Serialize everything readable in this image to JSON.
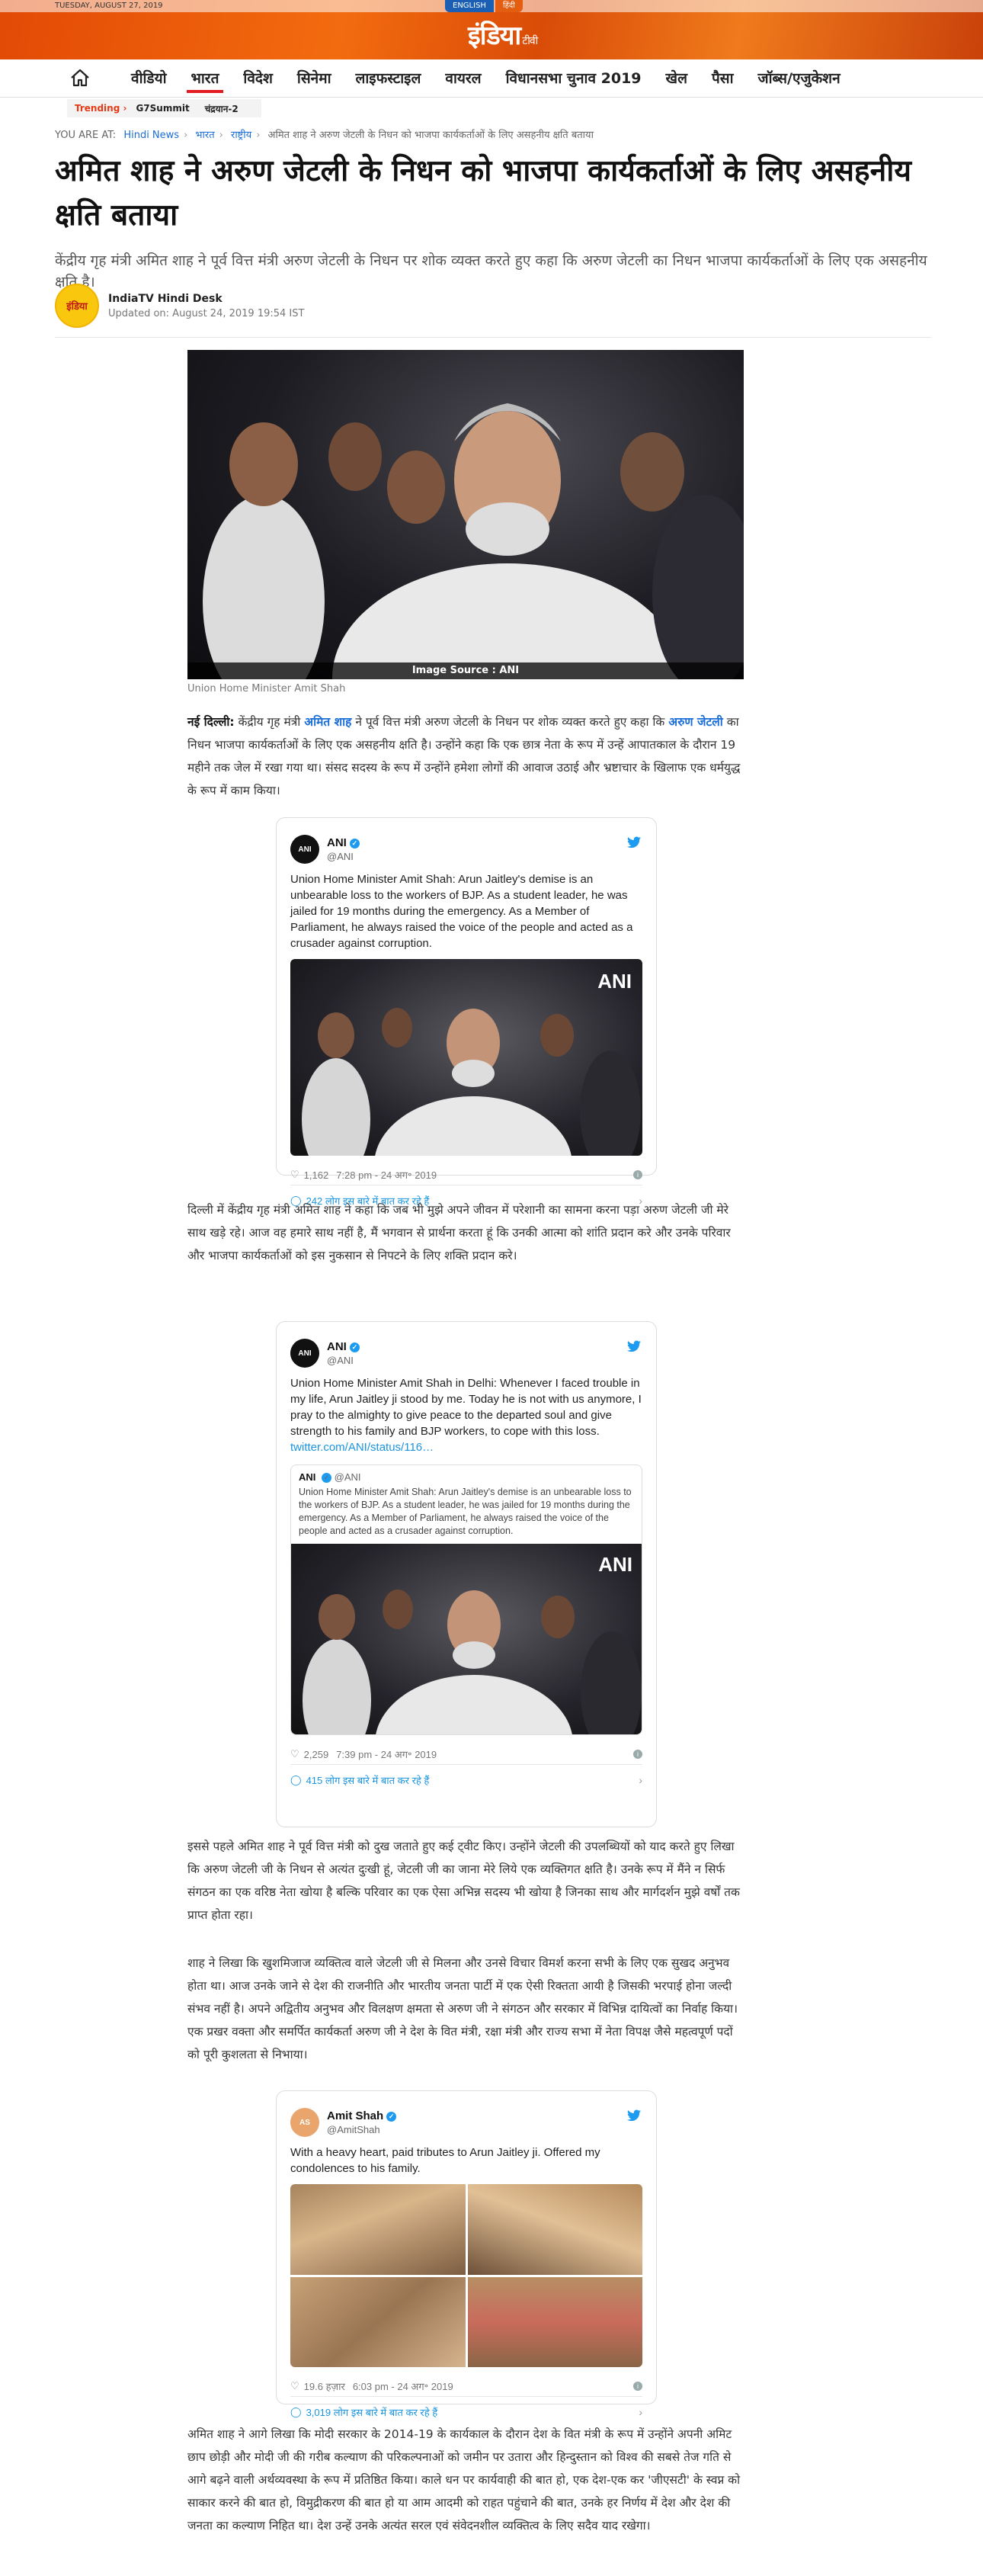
{
  "topbar": {
    "date": "TUESDAY, AUGUST 27, 2019",
    "lang_english": "ENGLISH",
    "lang_hindi": "हिंदी",
    "logo": "इंडिया",
    "logo_tv": "टीवी"
  },
  "nav": {
    "items": [
      {
        "label": "वीडियो"
      },
      {
        "label": "भारत"
      },
      {
        "label": "विदेश"
      },
      {
        "label": "सिनेमा"
      },
      {
        "label": "लाइफस्टाइल"
      },
      {
        "label": "वायरल"
      },
      {
        "label": "विधानसभा चुनाव 2019"
      },
      {
        "label": "खेल"
      },
      {
        "label": "पैसा"
      },
      {
        "label": "जॉब्स/एजुकेशन"
      }
    ],
    "active": "भारत"
  },
  "trending": {
    "label": "Trending ›",
    "links": [
      "G7Summit",
      "चंद्रयान-2"
    ]
  },
  "breadcrumb": {
    "prefix": "YOU ARE AT:",
    "items": [
      "Hindi News",
      "भारत",
      "राष्ट्रीय",
      "अमित शाह ने अरुण जेटली के निधन को भाजपा कार्यकर्ताओं के लिए असहनीय क्षति बताया"
    ]
  },
  "article": {
    "title": "अमित शाह ने अरुण जेटली के निधन को भाजपा कार्यकर्ताओं के लिए असहनीय क्षति बताया",
    "summary": "केंद्रीय गृह मंत्री अमित शाह ने पूर्व वित्त मंत्री अरुण जेटली के निधन पर शोक व्यक्त करते हुए कहा कि अरुण जेटली का निधन भाजपा कार्यकर्ताओं के लिए एक असहनीय क्षति है।",
    "author": "IndiaTV Hindi Desk",
    "author_badge": "इंडिया",
    "updated": "Updated on: August 24, 2019 19:54 IST",
    "image_credit": "Image Source : ANI",
    "image_caption": "Union Home Minister Amit Shah",
    "p1_dateline": "नई दिल्ली:",
    "p1_a": " केंद्रीय गृह मंत्री ",
    "p1_link1": "अमित शाह",
    "p1_b": " ने पूर्व वित्त मंत्री अरुण जेटली के निधन पर शोक व्यक्त करते हुए कहा कि ",
    "p1_link2": "अरुण जेटली",
    "p1_c": " का निधन भाजपा कार्यकर्ताओं के लिए एक असहनीय क्षति है। उन्होंने कहा कि एक छात्र नेता के रूप में उन्हें आपातकाल के दौरान 19 महीने तक जेल में रखा गया था। संसद सदस्य के रूप में उन्होंने हमेशा लोगों की आवाज उठाई और भ्रष्टाचार के खिलाफ एक धर्मयुद्ध के रूप में काम किया।",
    "p2": "दिल्ली में केंद्रीय गृह मंत्री अमित शाह ने कहा कि जब भी मुझे अपने जीवन में परेशानी का सामना करना पड़ा अरुण जेटली जी मेरे साथ खड़े रहे। आज वह हमारे साथ नहीं है, मैं भगवान से प्रार्थना करता हूं कि उनकी आत्मा को शांति प्रदान करे और उनके परिवार और भाजपा कार्यकर्ताओं को इस नुकसान से निपटने के लिए शक्ति प्रदान करे।",
    "p3": "इससे पहले अमित शाह ने पूर्व वित्त मंत्री को दुख जताते हुए कई ट्वीट किए। उन्होंने जेटली की उपलब्धियों को याद करते हुए लिखा कि अरुण जेटली जी के निधन से अत्यंत दुःखी हूं, जेटली जी का जाना मेरे लिये एक व्यक्तिगत क्षति है। उनके रूप में मैंने न सिर्फ संगठन का एक वरिष्ठ नेता खोया है बल्कि परिवार का एक ऐसा अभिन्न सदस्य भी खोया है जिनका साथ और मार्गदर्शन मुझे वर्षों तक प्राप्त होता रहा।",
    "p4": "शाह ने लिखा कि खुशमिजाज व्यक्तित्व वाले जेटली जी से मिलना और उनसे विचार विमर्श करना सभी के लिए एक सुखद अनुभव होता था। आज उनके जाने से देश की राजनीति और भारतीय जनता पार्टी में एक ऐसी रिक्तता आयी है जिसकी भरपाई होना जल्दी संभव नहीं है। अपने अद्वितीय अनुभव और विलक्षण क्षमता से अरुण जी ने संगठन और सरकार में विभिन्न दायित्वों का निर्वाह किया। एक प्रखर वक्ता और समर्पित कार्यकर्ता अरुण जी ने देश के वित मंत्री, रक्षा मंत्री और राज्य सभा में नेता विपक्ष जैसे महत्वपूर्ण पदों को पूरी कुशलता से निभाया।",
    "p5": "अमित शाह ने आगे लिखा कि मोदी सरकार के 2014-19 के कार्यकाल के दौरान देश के वित मंत्री के रूप में उन्होंने अपनी अमिट छाप छोड़ी और मोदी जी की गरीब कल्याण की परिकल्पनाओं को जमीन पर उतारा और हिन्दुस्तान को विश्व की सबसे तेज गति से आगे बढ़ने वाली अर्थव्यवस्था के रूप में प्रतिष्ठित किया। काले धन पर कार्यवाही की बात हो, एक देश-एक कर 'जीएसटी' के स्वप्न को साकार करने की बात हो, विमुद्रीकरण की बात हो या आम आदमी को राहत पहुंचाने की बात, उनके हर निर्णय में देश और देश की जनता का कल्याण निहित था। देश उन्हें उनके अत्यंत सरल एवं संवेदनशील व्यक्तित्व के लिए सदैव याद रखेगा।"
  },
  "tweets": [
    {
      "avatar": "ANI",
      "name": "ANI",
      "handle": "@ANI",
      "text": "Union Home Minister Amit Shah: Arun Jaitley's demise is an unbearable loss to the workers of BJP. As a student leader, he was jailed for 19 months during the emergency. As a Member of Parliament, he always raised the voice of the people and acted as a crusader against corruption.",
      "watermark": "ANI",
      "likes": "1,162",
      "time": "7:28 pm - 24 अग॰ 2019",
      "talk": "242 लोग इस बारे में बात कर रहे हैं"
    },
    {
      "avatar": "ANI",
      "name": "ANI",
      "handle": "@ANI",
      "text": "Union Home Minister Amit Shah in Delhi: Whenever I faced trouble in my life, Arun Jaitley ji stood by me. Today he is not with us anymore, I pray to the almighty to give peace to the departed soul and give strength to his family and BJP workers, to cope with this loss. ",
      "link": "twitter.com/ANI/status/116…",
      "quote_name": "ANI",
      "quote_handle": "@ANI",
      "quote_text": "Union Home Minister Amit Shah: Arun Jaitley's demise is an unbearable loss to the workers of BJP. As a student leader, he was jailed for 19 months during the emergency. As a Member of Parliament, he always raised the voice of the people and acted as a crusader against corruption.",
      "watermark": "ANI",
      "likes": "2,259",
      "time": "7:39 pm - 24 अग॰ 2019",
      "talk": "415 लोग इस बारे में बात कर रहे हैं"
    },
    {
      "avatar": "AS",
      "name": "Amit Shah",
      "handle": "@AmitShah",
      "text": "With a heavy heart, paid tributes to Arun Jaitley ji. Offered my condolences to his family.",
      "likes": "19.6 हज़ार",
      "time": "6:03 pm - 24 अग॰ 2019",
      "talk": "3,019 लोग इस बारे में बात कर रहे हैं"
    }
  ],
  "colors": {
    "brand_orange": "#f36b0f",
    "nav_active": "#e31b23",
    "link_blue": "#1a6ed8",
    "twitter_blue": "#1d9bf0"
  }
}
